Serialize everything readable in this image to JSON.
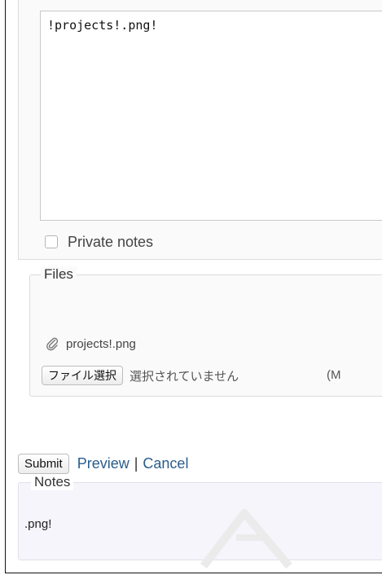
{
  "editor": {
    "textarea_value": "!projects!.png!",
    "private_notes_label": "Private notes",
    "private_notes_checked": false
  },
  "files": {
    "legend": "Files",
    "attachment_name": "projects!.png",
    "choose_file_label": "ファイル選択",
    "no_file_selected": "選択されていません",
    "max_size_partial": "(M"
  },
  "actions": {
    "submit_label": "Submit",
    "preview_label": "Preview",
    "separator": "|",
    "cancel_label": "Cancel"
  },
  "preview": {
    "legend": "Notes",
    "content": ".png!"
  },
  "colors": {
    "link": "#2a5d8c",
    "preview_background": "#f5f5fb"
  },
  "icons": {
    "attachment": "paperclip-icon",
    "watermark": "watermark-logo"
  }
}
